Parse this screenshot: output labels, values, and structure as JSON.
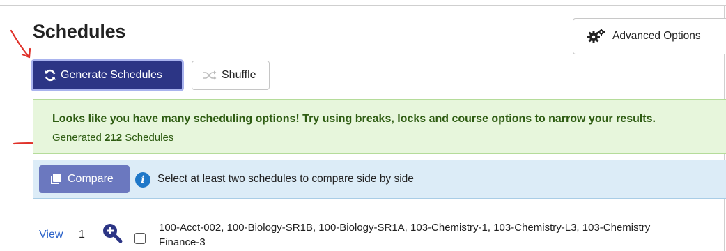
{
  "page": {
    "title": "Schedules"
  },
  "toolbar": {
    "advanced_label": "Advanced Options",
    "generate_label": "Generate Schedules",
    "shuffle_label": "Shuffle"
  },
  "success_alert": {
    "message": "Looks like you have many scheduling options! Try using breaks, locks and course options to narrow your results.",
    "generated_prefix": "Generated ",
    "generated_count": "212",
    "generated_suffix": " Schedules"
  },
  "info_alert": {
    "compare_label": "Compare",
    "text": "Select at least two schedules to compare side by side"
  },
  "schedules": [
    {
      "view_label": "View",
      "number": "1",
      "courses_line1": "100-Acct-002, 100-Biology-SR1B, 100-Biology-SR1A, 103-Chemistry-1, 103-Chemistry-L3, 103-Chemistry",
      "courses_line2": "Finance-3"
    }
  ],
  "colors": {
    "generate_bg": "#2c3585",
    "compare_bg": "#6b78bf",
    "success_bg": "#e7f6dc",
    "success_text": "#2e5c12",
    "info_bg": "#dcecf7",
    "link": "#2a62c9",
    "annotation_arrow": "#e0322a"
  },
  "icons": {
    "advanced": "gears-icon",
    "generate": "refresh-icon",
    "shuffle": "shuffle-icon",
    "compare": "copy-icon",
    "info": "info-icon",
    "zoom": "zoom-in-icon"
  }
}
